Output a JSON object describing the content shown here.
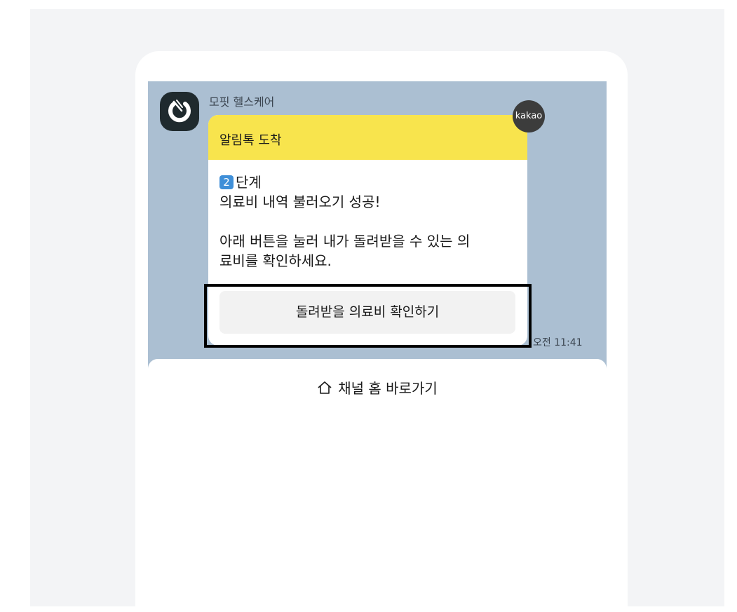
{
  "sender": {
    "name": "모핏 헬스케어"
  },
  "badge": {
    "label": "kakao"
  },
  "message": {
    "header_title": "알림톡 도착",
    "step_number": "2",
    "step_label": "단계",
    "line_success": "의료비 내역 불러오기 성공!",
    "line_instruction_1": "아래 버튼을 눌러 내가 돌려받을 수 있는 의",
    "line_instruction_2": "료비를 확인하세요.",
    "button_label": "돌려받을 의료비 확인하기",
    "timestamp": "오전 11:41"
  },
  "footer": {
    "channel_home_label": "채널 홈 바로가기"
  },
  "colors": {
    "chat_background": "#abbfd2",
    "header_yellow": "#f8e44d",
    "focus_border": "#000000"
  },
  "icons": {
    "avatar": "app-logo-icon",
    "home": "home-icon"
  }
}
